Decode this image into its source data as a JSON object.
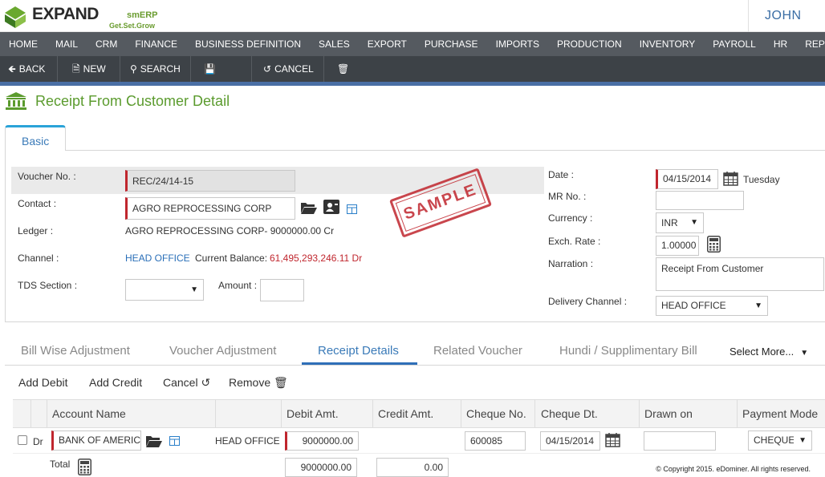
{
  "header": {
    "logo_main": "EXPAND",
    "logo_sm": "smERP",
    "logo_tagline": "Get.Set.Grow",
    "user": "JOHN"
  },
  "nav": [
    "HOME",
    "MAIL",
    "CRM",
    "FINANCE",
    "BUSINESS DEFINITION",
    "SALES",
    "EXPORT",
    "PURCHASE",
    "IMPORTS",
    "PRODUCTION",
    "INVENTORY",
    "PAYROLL",
    "HR",
    "REPO"
  ],
  "toolbar": {
    "back": "BACK",
    "new": "NEW",
    "search": "SEARCH",
    "save": "SAVE",
    "cancel": "CANCEL",
    "delete": "DELETE"
  },
  "page": {
    "title": "Receipt From Customer Detail",
    "tab_basic": "Basic",
    "stamp": "SAMPLE"
  },
  "form": {
    "voucher_label": "Voucher No. :",
    "voucher_value": "REC/24/14-15",
    "contact_label": "Contact :",
    "contact_value": "AGRO REPROCESSING CORP",
    "ledger_label": "Ledger :",
    "ledger_value": "AGRO REPROCESSING CORP- 9000000.00 Cr",
    "channel_label": "Channel :",
    "channel_value": "HEAD OFFICE",
    "balance_label": "Current Balance:",
    "balance_value": "61,495,293,246.11 Dr",
    "tds_label": "TDS Section :",
    "tds_value": "",
    "amount_label": "Amount :",
    "amount_value": "",
    "date_label": "Date :",
    "date_value": "04/15/2014",
    "date_day": "Tuesday",
    "mr_label": "MR No. :",
    "mr_value": "",
    "currency_label": "Currency :",
    "currency_value": "INR",
    "exch_label": "Exch. Rate :",
    "exch_value": "1.00000",
    "narration_label": "Narration :",
    "narration_value": "Receipt From Customer",
    "delivery_label": "Delivery Channel :",
    "delivery_value": "HEAD OFFICE"
  },
  "subtabs": [
    "Bill Wise Adjustment",
    "Voucher Adjustment",
    "Receipt Details",
    "Related Voucher",
    "Hundi / Supplimentary Bill",
    "Select More..."
  ],
  "actions": {
    "add_debit": "Add Debit",
    "add_credit": "Add Credit",
    "cancel": "Cancel",
    "remove": "Remove"
  },
  "grid": {
    "headers": {
      "account": "Account Name",
      "debit": "Debit Amt.",
      "credit": "Credit Amt.",
      "cheque_no": "Cheque No.",
      "cheque_dt": "Cheque Dt.",
      "drawn_on": "Drawn on",
      "payment_mode": "Payment Mode"
    },
    "row": {
      "drcr": "Dr",
      "account": "BANK OF AMERIC",
      "channel": "HEAD OFFICE",
      "debit": "9000000.00",
      "credit": "",
      "cheque_no": "600085",
      "cheque_dt": "04/15/2014",
      "drawn_on": "",
      "payment_mode": "CHEQUE"
    },
    "total_label": "Total",
    "total_debit": "9000000.00",
    "total_credit": "0.00"
  },
  "footer": "© Copyright 2015. eDominer. All rights reserved."
}
